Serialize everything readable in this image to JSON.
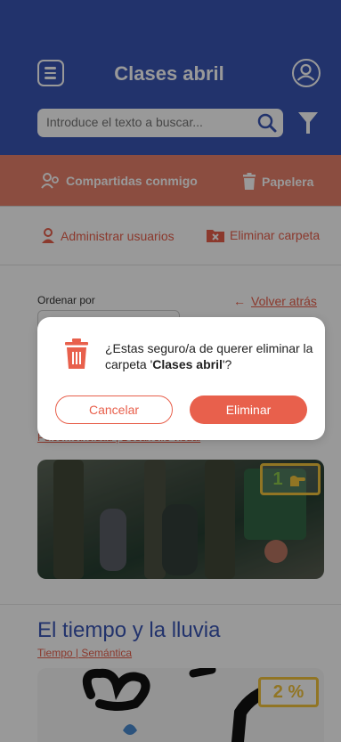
{
  "header": {
    "title": "Clases abril",
    "search_placeholder": "Introduce el texto a buscar...",
    "menu_icon": "hamburger-menu-icon",
    "user_icon": "user-profile-icon",
    "search_icon": "magnifier-icon",
    "filter_icon": "funnel-filter-icon"
  },
  "toolbar": {
    "shared_label": "Compartidas conmigo",
    "trash_label": "Papelera",
    "manage_users_label": "Administrar usuarios",
    "delete_folder_label": "Eliminar carpeta"
  },
  "sort": {
    "label": "Ordenar por",
    "back_label": "Volver atrás",
    "back_arrow": "←"
  },
  "cards": [
    {
      "tags": "Psicomotricidad | Desarrollo visual",
      "badge_value": "1"
    },
    {
      "title": "El tiempo y la lluvia",
      "tags": "Tiempo | Semántica",
      "badge_value": "2 %"
    }
  ],
  "dialog": {
    "text_before": "¿Estas seguro/a de querer eliminar la carpeta '",
    "folder_name": "Clases abril",
    "text_after": "'?",
    "cancel_label": "Cancelar",
    "confirm_label": "Eliminar",
    "icon": "trash-can-icon"
  },
  "colors": {
    "primary": "#3a55b4",
    "accent": "#e8604c",
    "badge": "#f2c43c"
  }
}
